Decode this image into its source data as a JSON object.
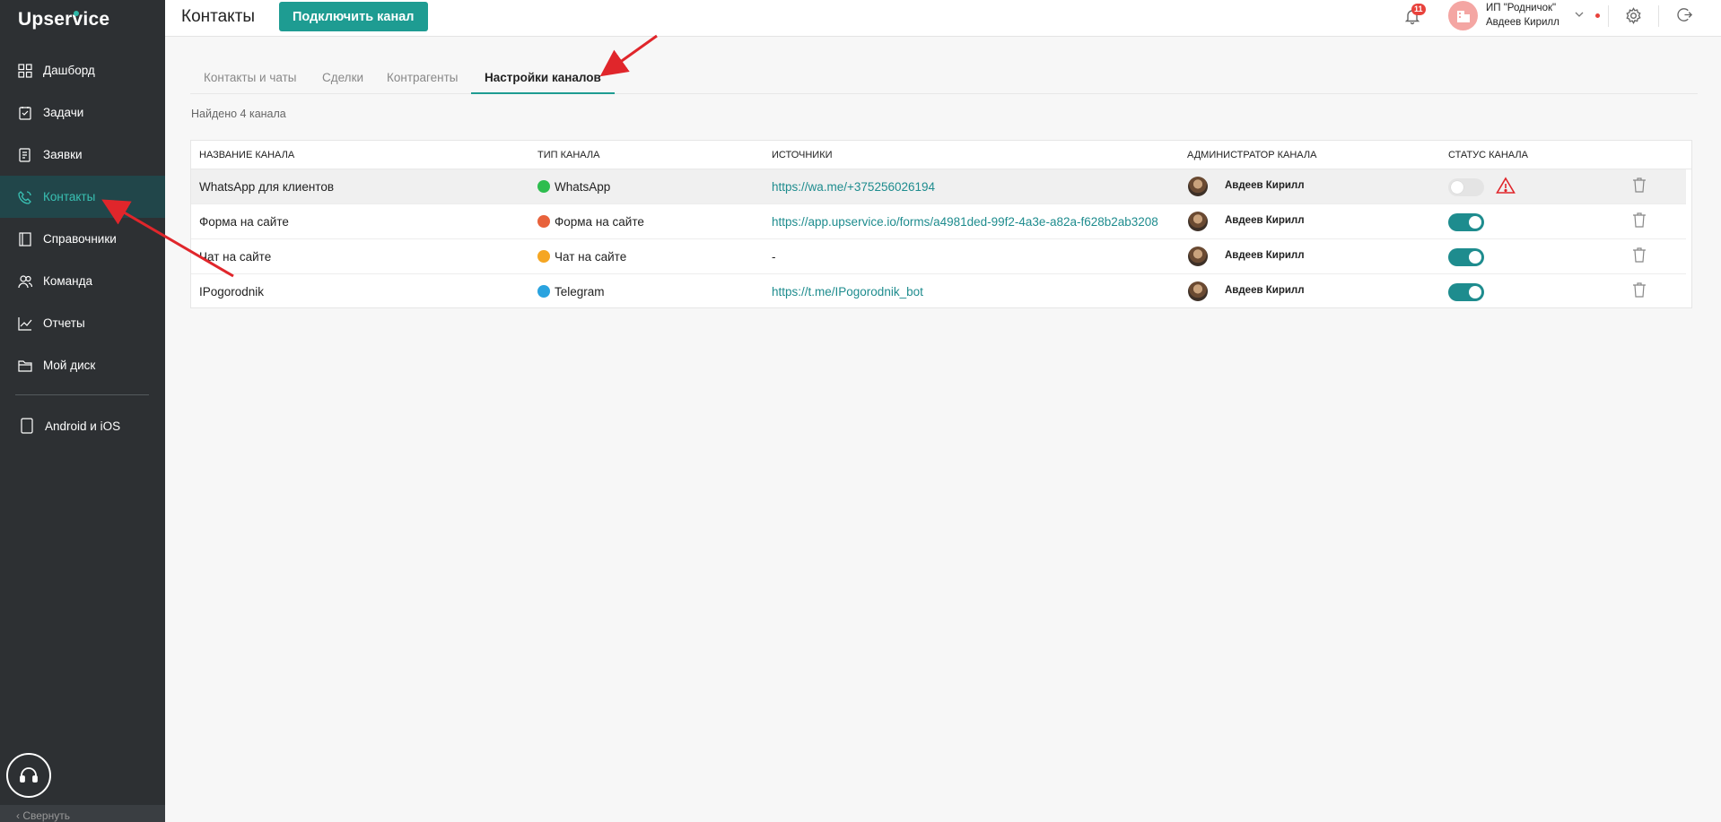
{
  "app": {
    "logo_text": "Upservice"
  },
  "sidebar": {
    "items": [
      {
        "label": "Дашборд",
        "icon": "dashboard-icon"
      },
      {
        "label": "Задачи",
        "icon": "tasks-icon"
      },
      {
        "label": "Заявки",
        "icon": "requests-icon"
      },
      {
        "label": "Контакты",
        "icon": "contacts-icon",
        "active": true
      },
      {
        "label": "Справочники",
        "icon": "book-icon"
      },
      {
        "label": "Команда",
        "icon": "team-icon"
      },
      {
        "label": "Отчеты",
        "icon": "chart-icon"
      },
      {
        "label": "Мой диск",
        "icon": "folder-icon"
      }
    ],
    "mobile_label": "Android и iOS",
    "collapse_label": "Свернуть"
  },
  "header": {
    "title": "Контакты",
    "connect_button": "Подключить канал",
    "notifications_count": "11",
    "company_line1": "ИП \"Родничок\"",
    "company_line2": "Авдеев Кирилл"
  },
  "tabs": [
    {
      "label": "Контакты и чаты"
    },
    {
      "label": "Сделки"
    },
    {
      "label": "Контрагенты"
    },
    {
      "label": "Настройки каналов",
      "active": true
    }
  ],
  "found_text": "Найдено 4 канала",
  "table": {
    "columns": [
      "Название канала",
      "Тип канала",
      "Источники",
      "Администратор канала",
      "Статус канала"
    ],
    "rows": [
      {
        "name": "WhatsApp для клиентов",
        "type": "WhatsApp",
        "type_color": "#2ebd4e",
        "source": "https://wa.me/+375256026194",
        "admin": "Авдеев Кирилл",
        "status_on": false,
        "warning": true
      },
      {
        "name": "Форма на сайте",
        "type": "Форма на сайте",
        "type_color": "#e8623c",
        "source": "https://app.upservice.io/forms/a4981ded-99f2-4a3e-a82a-f628b2ab3208",
        "admin": "Авдеев Кирилл",
        "status_on": true,
        "warning": false
      },
      {
        "name": "Чат на сайте",
        "type": "Чат на сайте",
        "type_color": "#f5a623",
        "source": "-",
        "admin": "Авдеев Кирилл",
        "status_on": true,
        "warning": false
      },
      {
        "name": "IPogorodnik",
        "type": "Telegram",
        "type_color": "#2aa3df",
        "source": "https://t.me/IPogorodnik_bot",
        "admin": "Авдеев Кирилл",
        "status_on": true,
        "warning": false
      }
    ]
  },
  "colors": {
    "accent": "#1e9c92",
    "sidebar_bg": "#2d3033",
    "annotation": "#e0262b"
  }
}
